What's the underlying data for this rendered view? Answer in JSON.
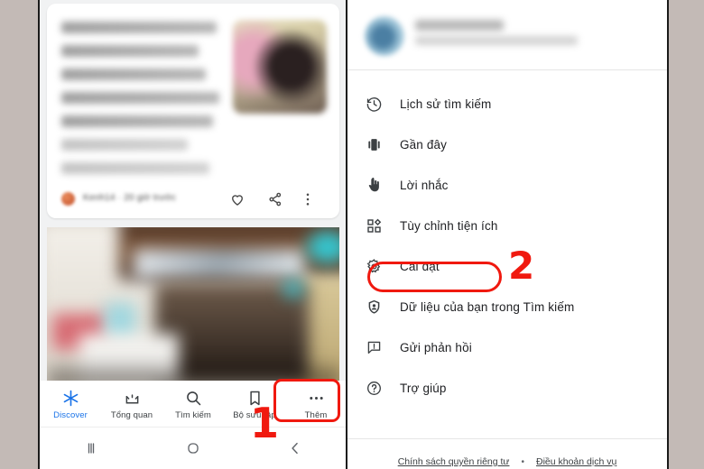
{
  "background_color": "#c3bab6",
  "accent_red": "#f0190f",
  "accent_blue": "#1a73e8",
  "left_phone": {
    "feed_card": {
      "source_name": "Kenh14",
      "timestamp": "20 giờ trước",
      "source_separator": "·",
      "actions": [
        "heart-icon",
        "share-icon",
        "more-vertical-icon"
      ]
    },
    "tab_bar": [
      {
        "label": "Discover",
        "icon": "discover-asterisk-icon",
        "active": true
      },
      {
        "label": "Tổng quan",
        "icon": "overview-icon",
        "active": false
      },
      {
        "label": "Tìm kiếm",
        "icon": "search-icon",
        "active": false
      },
      {
        "label": "Bộ sưu tập",
        "icon": "bookmark-icon",
        "active": false
      },
      {
        "label": "Thêm",
        "icon": "more-horizontal-icon",
        "active": false
      }
    ],
    "system_nav": [
      {
        "name": "recents-button",
        "icon": "three-bars-icon"
      },
      {
        "name": "home-button",
        "icon": "circle-icon"
      },
      {
        "name": "back-button",
        "icon": "chevron-left-icon"
      }
    ]
  },
  "right_phone": {
    "account": {
      "name_blurred": true,
      "email_blurred": true,
      "avatar": "account-avatar"
    },
    "menu_items": [
      {
        "label": "Lịch sử tìm kiếm",
        "icon": "history-clock-icon"
      },
      {
        "label": "Gần đây",
        "icon": "recent-cards-icon"
      },
      {
        "label": "Lời nhắc",
        "icon": "reminder-hand-icon"
      },
      {
        "label": "Tùy chỉnh tiện ích",
        "icon": "widgets-icon"
      },
      {
        "label": "Cài đặt",
        "icon": "gear-icon",
        "highlighted": true
      },
      {
        "label": "Dữ liệu của bạn trong Tìm kiếm",
        "icon": "shield-person-icon"
      },
      {
        "label": "Gửi phản hồi",
        "icon": "feedback-icon"
      },
      {
        "label": "Trợ giúp",
        "icon": "help-circle-icon"
      }
    ],
    "footer": {
      "privacy_link": "Chính sách quyền riêng tư",
      "separator": "•",
      "terms_link": "Điều khoản dịch vụ"
    }
  },
  "annotations": {
    "step_one": "1",
    "step_two": "2"
  }
}
